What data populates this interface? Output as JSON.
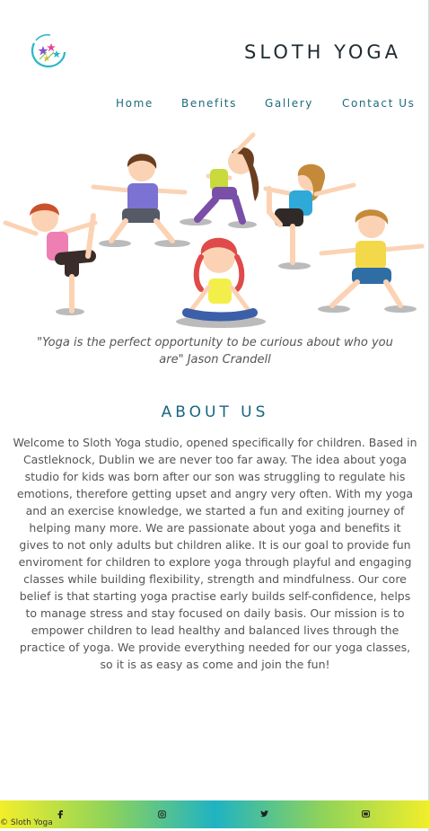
{
  "header": {
    "brand": "SLOTH YOGA",
    "logo_icon": "stars-circle-logo-icon"
  },
  "nav": {
    "items": [
      {
        "label": "Home"
      },
      {
        "label": "Benefits"
      },
      {
        "label": "Gallery"
      },
      {
        "label": "Contact Us"
      }
    ]
  },
  "hero": {
    "image_icon": "kids-yoga-illustration",
    "quote": "\"Yoga is the perfect opportunity to be curious about who you are\" Jason Crandell"
  },
  "about": {
    "title": "ABOUT US",
    "body": "Welcome to Sloth Yoga studio, opened specifically for children. Based in Castleknock, Dublin we are never too far away. The idea about yoga studio for kids was born after our son was struggling to regulate his emotions, therefore getting upset and angry very often. With my yoga and an exercise knowledge, we started a fun and exiting journey of helping many more. We are passionate about yoga and benefits it gives to not only adults but children alike. It is our goal to provide fun enviroment for children to explore yoga through playful and engaging classes while building flexibility, strength and mindfulness. Our core belief is that starting yoga practise early builds self-confidence, helps to manage stress and stay focused on daily basis. Our mission is to empower children to lead healthy and balanced lives through the practice of yoga. We provide everything needed for our yoga classes, so it is as easy as come and join the fun!"
  },
  "footer": {
    "copyright": "© Sloth Yoga",
    "social": [
      "facebook-icon",
      "instagram-icon",
      "twitter-icon",
      "youtube-icon"
    ],
    "gradient_colors": [
      "#f2ee2a",
      "#8fd35a",
      "#1fb3c2"
    ]
  },
  "colors": {
    "nav_text": "#1e6a7a",
    "heading": "#1a6580",
    "body_text": "#555555"
  }
}
